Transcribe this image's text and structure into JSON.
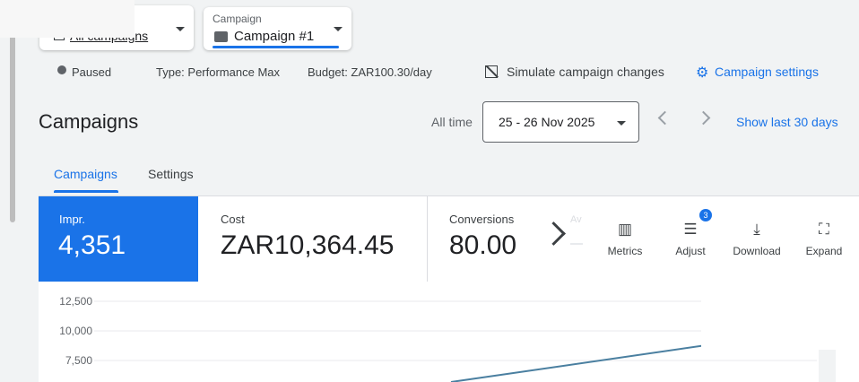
{
  "filters": {
    "all_campaigns_value": "All campaigns",
    "campaign_label": "Campaign",
    "campaign_value": "Campaign #1"
  },
  "status_bar": {
    "status": "Paused",
    "type": "Type: Performance Max",
    "budget": "Budget: ZAR100.30/day",
    "simulate": "Simulate campaign changes",
    "settings": "Campaign settings"
  },
  "header": {
    "title": "Campaigns",
    "range_label": "All time",
    "date_range": "25 - 26 Nov 2025",
    "show_last": "Show last 30 days"
  },
  "tabs": [
    {
      "label": "Campaigns"
    },
    {
      "label": "Settings"
    }
  ],
  "metrics": {
    "impr": {
      "label": "Impr.",
      "value": "4,351"
    },
    "cost": {
      "label": "Cost",
      "value": "ZAR10,364.45"
    },
    "conversions": {
      "label": "Conversions",
      "value": "80.00"
    },
    "faded_label": "Av"
  },
  "tools": [
    {
      "label": "Metrics",
      "icon": "metrics-icon"
    },
    {
      "label": "Adjust",
      "icon": "adjust-icon",
      "badge": "3"
    },
    {
      "label": "Download",
      "icon": "download-icon"
    },
    {
      "label": "Expand",
      "icon": "expand-icon"
    }
  ],
  "chart_data": {
    "type": "line",
    "y_ticks": [
      "12,500",
      "10,000",
      "7,500"
    ],
    "ylim": [
      0,
      12500
    ],
    "series_color": "#4a7fa0"
  },
  "colors": {
    "accent": "#1a73e8",
    "text": "#202124"
  }
}
